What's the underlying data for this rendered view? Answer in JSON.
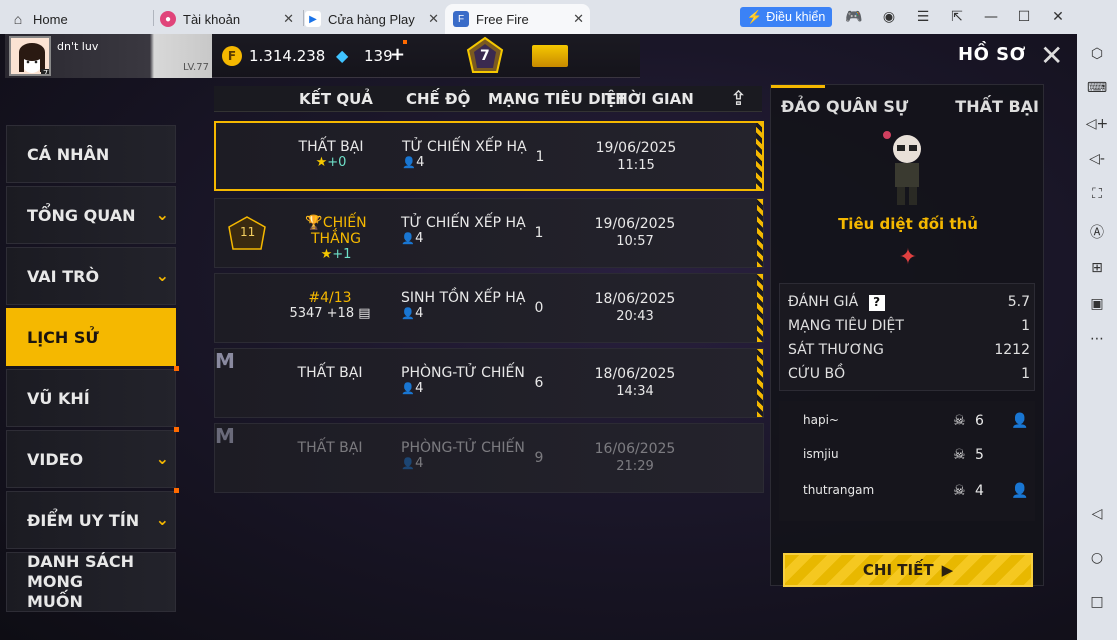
{
  "browser": {
    "tabs": [
      {
        "label": "Home",
        "icon": "home-icon"
      },
      {
        "label": "Tài khoản",
        "icon": "account-app-icon"
      },
      {
        "label": "Cửa hàng Play",
        "icon": "play-store-icon"
      },
      {
        "label": "Free Fire",
        "icon": "free-fire-icon"
      }
    ],
    "control_label": "Điều khiển",
    "accent": "#3b82f6"
  },
  "profile": {
    "name": "dn't luv",
    "level": "LV.77",
    "avatar_level": "77"
  },
  "currency": {
    "coins": "1.314.238",
    "diamonds": "139",
    "plus": "+",
    "rank_number": "7"
  },
  "header": {
    "title": "HỒ SƠ"
  },
  "nav": [
    {
      "label": "CÁ NHÂN",
      "chevron": false,
      "active": false,
      "dot": false
    },
    {
      "label": "TỔNG QUAN",
      "chevron": true,
      "active": false,
      "dot": false
    },
    {
      "label": "VAI TRÒ",
      "chevron": true,
      "active": false,
      "dot": false
    },
    {
      "label": "LỊCH SỬ",
      "chevron": false,
      "active": true,
      "dot": false
    },
    {
      "label": "VŨ KHÍ",
      "chevron": false,
      "active": false,
      "dot": true
    },
    {
      "label": "VIDEO",
      "chevron": true,
      "active": false,
      "dot": true
    },
    {
      "label": "ĐIỂM UY TÍN",
      "chevron": true,
      "active": false,
      "dot": true
    },
    {
      "label": "DANH SÁCH MONG MUỐN",
      "chevron": false,
      "active": false,
      "dot": false
    }
  ],
  "table": {
    "columns": [
      "KẾT QUẢ",
      "CHẾ ĐỘ",
      "MẠNG TIÊU DIỆT",
      "THỜI GIAN"
    ],
    "rows": [
      {
        "result": "THẤT BẠI",
        "result_sub": "+0",
        "mode": "TỬ CHIẾN XẾP HẠ",
        "players": "4",
        "kills": "1",
        "date": "19/06/2025",
        "time": "11:15",
        "selected": true,
        "faded": false,
        "badge": ""
      },
      {
        "result": "CHIẾN THẮNG",
        "result_sub": "+1",
        "mode": "TỬ CHIẾN XẾP HẠ",
        "players": "4",
        "kills": "1",
        "date": "19/06/2025",
        "time": "10:57",
        "selected": false,
        "faded": false,
        "badge": "11"
      },
      {
        "result": "#4/13",
        "result_sub": "5347 +18",
        "mode": "SINH TỒN XẾP HẠ",
        "players": "4",
        "kills": "0",
        "date": "18/06/2025",
        "time": "20:43",
        "selected": false,
        "faded": false,
        "badge": ""
      },
      {
        "result": "THẤT BẠI",
        "result_sub": "",
        "mode": "PHÒNG-TỬ CHIẾN",
        "players": "4",
        "kills": "6",
        "date": "18/06/2025",
        "time": "14:34",
        "selected": false,
        "faded": false,
        "badge": "M"
      },
      {
        "result": "THẤT BẠI",
        "result_sub": "",
        "mode": "PHÒNG-TỬ CHIẾN",
        "players": "4",
        "kills": "9",
        "date": "16/06/2025",
        "time": "21:29",
        "selected": false,
        "faded": true,
        "badge": "M"
      }
    ]
  },
  "detail": {
    "map": "ĐẢO QUÂN SỰ",
    "outcome": "THẤT BẠI",
    "caption": "Tiêu diệt đối thủ",
    "stats": [
      {
        "label": "ĐÁNH GIÁ",
        "value": "5.7",
        "help": true
      },
      {
        "label": "MẠNG TIÊU DIỆT",
        "value": "1",
        "help": false
      },
      {
        "label": "SÁT THƯƠNG",
        "value": "1212",
        "help": false
      },
      {
        "label": "CỨU BỒ",
        "value": "1",
        "help": false
      }
    ],
    "players": [
      {
        "name": "hapi~",
        "kills": "6",
        "add": true
      },
      {
        "name": "ismjiu",
        "kills": "5",
        "add": false
      },
      {
        "name": "thutrangam",
        "kills": "4",
        "add": true
      }
    ],
    "button_label": "CHI TIẾT"
  }
}
